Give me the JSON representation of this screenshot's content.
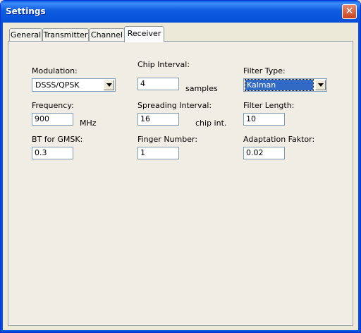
{
  "window": {
    "title": "Settings"
  },
  "tabs": [
    "General",
    "Transmitter",
    "Channel",
    "Receiver"
  ],
  "fields": {
    "modulation": {
      "label": "Modulation:",
      "value": "DSSS/QPSK"
    },
    "chip_interval": {
      "label": "Chip Interval:",
      "value": "4",
      "unit": "samples"
    },
    "filter_type": {
      "label": "Filter Type:",
      "value": "Kalman"
    },
    "frequency": {
      "label": "Frequency:",
      "value": "900",
      "unit": "MHz"
    },
    "spreading_interval": {
      "label": "Spreading Interval:",
      "value": "16",
      "unit": "chip int."
    },
    "filter_length": {
      "label": "Filter Length:",
      "value": "10"
    },
    "bt_gmsk": {
      "label": "BT for GMSK:",
      "value": "0.3"
    },
    "finger_number": {
      "label": "Finger Number:",
      "value": "1"
    },
    "adaptation_faktor": {
      "label": "Adaptation Faktor:",
      "value": "0.02"
    }
  },
  "icons": {
    "close": "close-icon",
    "dropdown": "chevron-down-icon"
  }
}
